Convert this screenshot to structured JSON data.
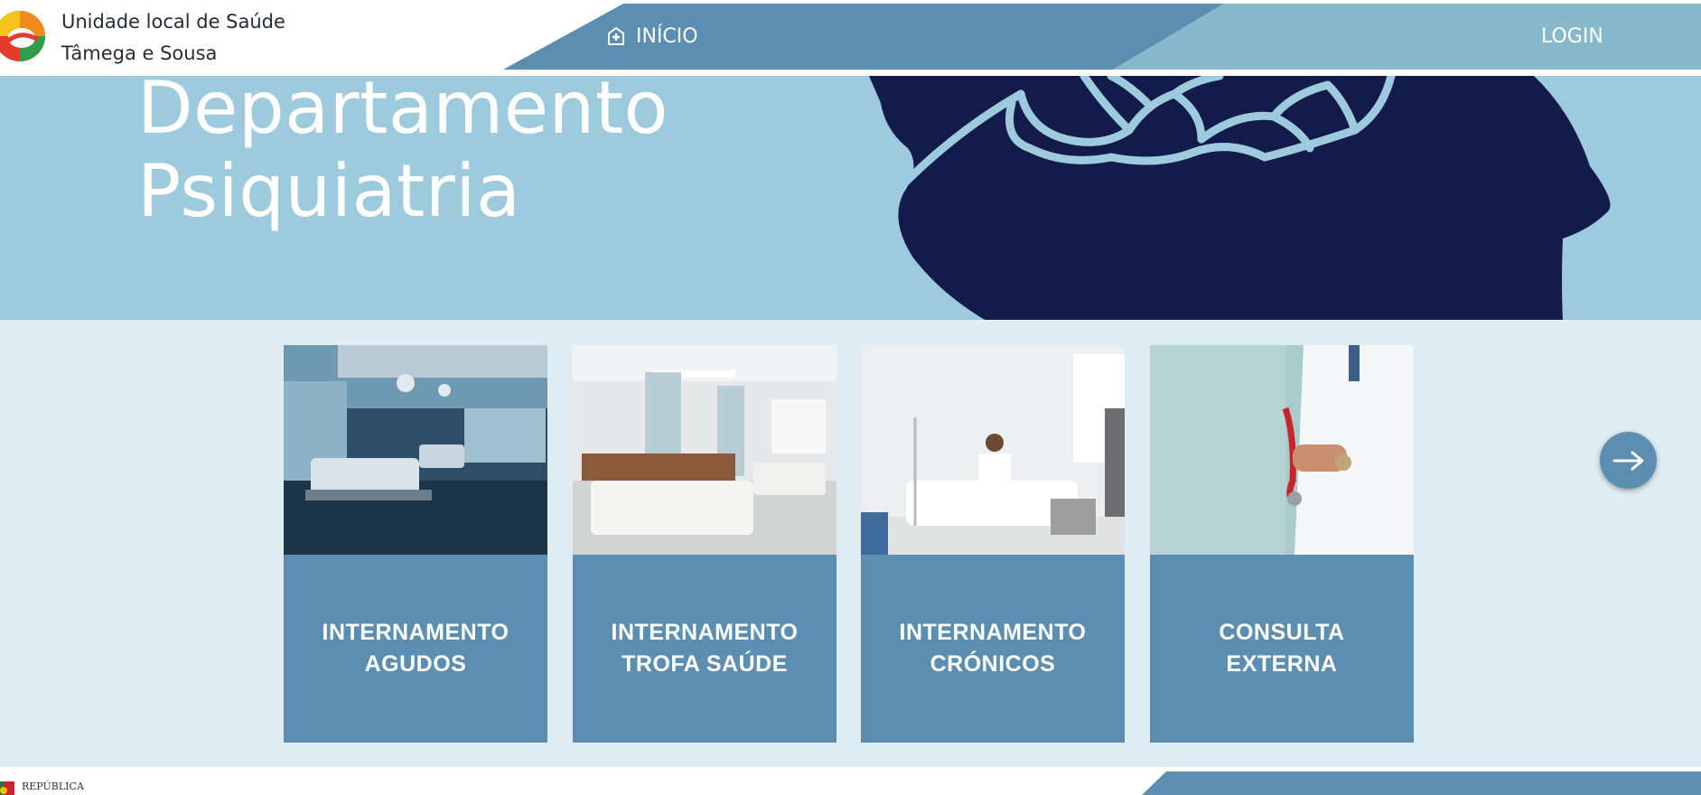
{
  "header": {
    "org_name_line1": "Unidade local de Saúde",
    "org_name_line2": "Tâmega e Sousa",
    "nav": {
      "home_label": "INÍCIO",
      "home_icon": "hospital-plus-icon",
      "login_label": "LOGIN"
    }
  },
  "hero": {
    "title_line1": "Departamento",
    "title_line2": "Psiquiatria"
  },
  "cards": [
    {
      "line1": "INTERNAMENTO",
      "line2": "AGUDOS"
    },
    {
      "line1": "INTERNAMENTO",
      "line2": "TROFA SAÚDE"
    },
    {
      "line1": "INTERNAMENTO",
      "line2": "CRÓNICOS"
    },
    {
      "line1": "CONSULTA",
      "line2": "EXTERNA"
    }
  ],
  "carousel": {
    "next_icon": "arrow-right-icon"
  },
  "footer": {
    "republica_label": "REPÚBLICA"
  },
  "colors": {
    "nav_dark": "#5b8eb1",
    "nav_light": "#88b8cb",
    "hero_bg": "#9ecadd",
    "head_silhouette": "#131b4a",
    "cards_bg": "#dfecf1",
    "card_label_bg": "#5b8eb1"
  }
}
